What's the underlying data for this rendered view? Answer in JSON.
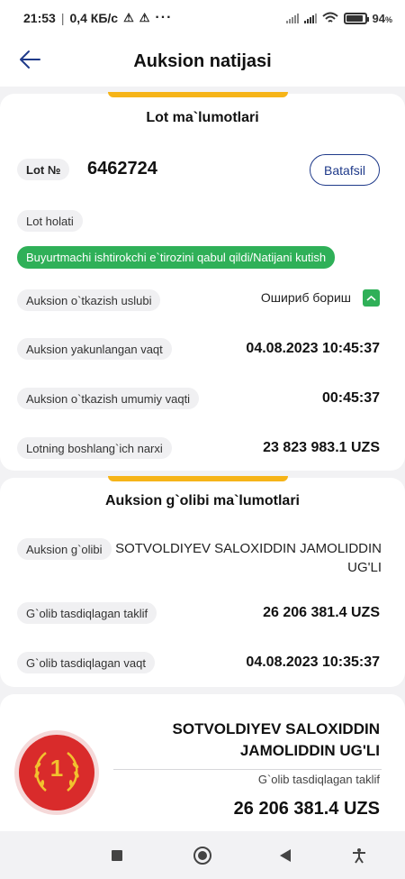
{
  "status_bar": {
    "time": "21:53",
    "speed": "0,4 КБ/с",
    "dots": "···",
    "battery_pct": "94",
    "battery_unit": "%",
    "battery_level": 0.94
  },
  "header": {
    "title": "Auksion natijasi"
  },
  "lot_card": {
    "title": "Lot ma`lumotlari",
    "lot_label": "Lot №",
    "lot_number": "6462724",
    "details_button": "Batafsil",
    "status_label": "Lot holati",
    "status_value": "Buyurtmachi ishtirokchi e`tirozini qabul qildi/Natijani kutish",
    "method_label": "Auksion o`tkazish uslubi",
    "method_value": "Ошириб бориш",
    "end_time_label": "Auksion yakunlangan vaqt",
    "end_time_value": "04.08.2023 10:45:37",
    "duration_label": "Auksion o`tkazish umumiy vaqti",
    "duration_value": "00:45:37",
    "start_price_label": "Lotning boshlang`ich narxi",
    "start_price_value": "23 823 983.1 UZS"
  },
  "winner_card": {
    "title": "Auksion g`olibi ma`lumotlari",
    "winner_label": "Auksion g`olibi",
    "winner_name": "SOTVOLDIYEV SALOXIDDIN JAMOLIDDIN UG'LI",
    "offer_label": "G`olib tasdiqlagan taklif",
    "offer_value": "26 206 381.4 UZS",
    "time_label": "G`olib tasdiqlagan vaqt",
    "time_value": "04.08.2023 10:35:37"
  },
  "summary_card": {
    "rank": "1",
    "name": "SOTVOLDIYEV SALOXIDDIN JAMOLIDDIN UG'LI",
    "offer_label": "G`olib tasdiqlagan taklif",
    "offer_value": "26 206 381.4 UZS"
  },
  "colors": {
    "accent_yellow": "#f6b418",
    "status_green": "#2fb058",
    "link_blue": "#1f3a8a",
    "medal_red": "#d92b2b",
    "medal_gold": "#f2c12e"
  },
  "icons": [
    "back-arrow-icon",
    "warning-icon",
    "signal-icon",
    "wifi-icon",
    "battery-icon",
    "chevron-up-icon",
    "laurel-icon",
    "stop-icon",
    "home-icon",
    "back-icon",
    "accessibility-icon"
  ]
}
